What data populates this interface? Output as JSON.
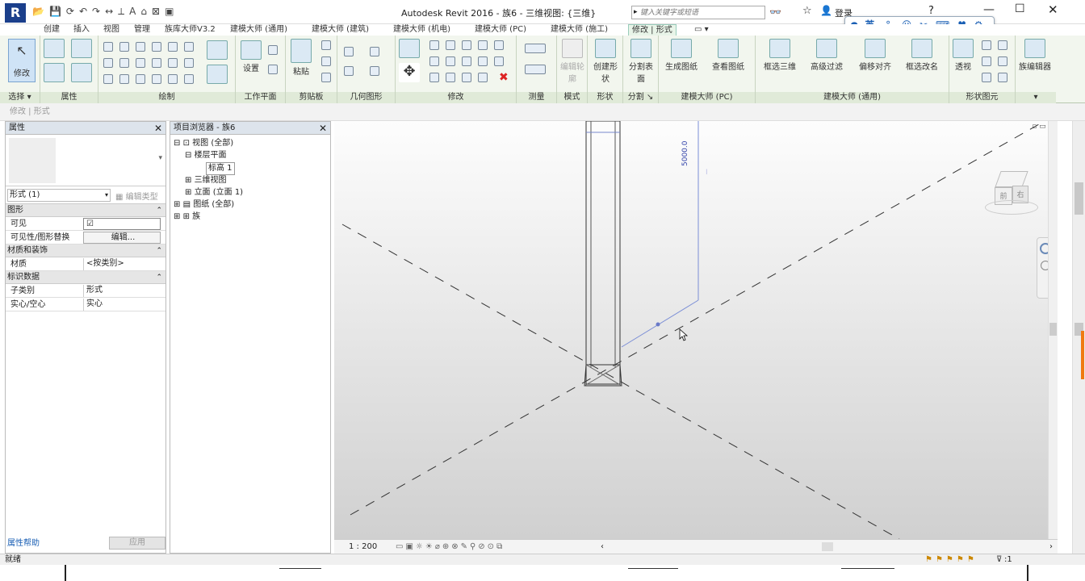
{
  "window": {
    "title": "Autodesk Revit 2016 -    族6 - 三维视图: {三维}",
    "search_placeholder": "键入关键字或短语",
    "login": "登录"
  },
  "tabs": [
    {
      "label": "创建"
    },
    {
      "label": "插入"
    },
    {
      "label": "视图"
    },
    {
      "label": "管理"
    },
    {
      "label": "族库大师V3.2"
    },
    {
      "label": "建模大师 (通用)"
    },
    {
      "label": "建模大师 (建筑)"
    },
    {
      "label": "建模大师 (机电)"
    },
    {
      "label": "建模大师 (PC)"
    },
    {
      "label": "建模大师 (施工)"
    },
    {
      "label": "修改 | 形式"
    }
  ],
  "ribbon": {
    "modify": "修改",
    "panels": {
      "select": "选择",
      "properties": "属性",
      "draw": "绘制",
      "workplane": "工作平面",
      "clipboard": "剪贴板",
      "geometry": "几何图形",
      "modify": "修改",
      "measure": "测量",
      "mode": "模式",
      "form": "形状",
      "divide": "分割",
      "master_pc": "建模大师 (PC)",
      "master_general": "建模大师 (通用)",
      "form_element": "形状图元"
    },
    "buttons": {
      "set": "设置",
      "paste": "粘贴",
      "edit_profile": "编辑轮廓",
      "create_form": "创建形状",
      "divide_surface": "分割表面",
      "gen_drawing": "生成图纸",
      "view_drawing": "查看图纸",
      "box_3d": "框选三维",
      "adv_filter": "高级过滤",
      "offset_align": "偏移对齐",
      "box_rename": "框选改名",
      "xray": "透视",
      "family_editor": "族编辑器"
    }
  },
  "context_bar": "修改 | 形式",
  "ime": {
    "lang": "英"
  },
  "properties": {
    "title": "属性",
    "type_selector": "形式 (1)",
    "edit_type": "编辑类型",
    "sections": [
      {
        "name": "图形",
        "rows": [
          {
            "k": "可见",
            "v": "☑"
          },
          {
            "k": "可见性/图形替换",
            "v": "编辑..."
          }
        ]
      },
      {
        "name": "材质和装饰",
        "rows": [
          {
            "k": "材质",
            "v": "<按类别>"
          }
        ]
      },
      {
        "name": "标识数据",
        "rows": [
          {
            "k": "子类别",
            "v": "形式"
          },
          {
            "k": "实心/空心",
            "v": "实心"
          }
        ]
      }
    ],
    "help": "属性帮助",
    "apply": "应用"
  },
  "browser": {
    "title": "项目浏览器 - 族6",
    "items": [
      "视图 (全部)",
      "楼层平面",
      "标高 1",
      "三维视图",
      "立面 (立面 1)",
      "图纸 (全部)",
      "族"
    ]
  },
  "viewport": {
    "dimension": "5000.0",
    "cube_front": "前",
    "cube_right": "右"
  },
  "viewbar": {
    "scale": "1 : 200"
  },
  "status": {
    "text": "就绪",
    "filter": ":1"
  }
}
